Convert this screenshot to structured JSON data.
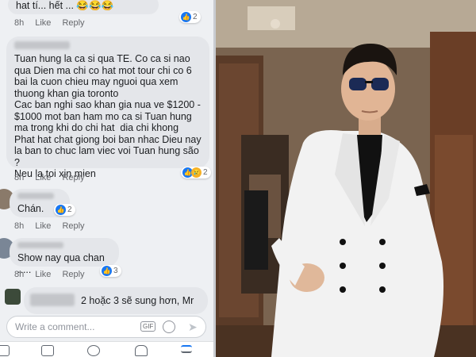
{
  "thread": {
    "top": {
      "text": "hat tí... hết ... 😂😂😂",
      "time": "8h",
      "like": "Like",
      "reply": "Reply",
      "reactions": "2"
    },
    "comments": [
      {
        "text": "Tuan hung la ca si qua TE. Co ca si nao qua Dien ma chi co hat mot tour chi co 6 bai la cuon chieu may nguoi qua xem thuong khan gia toronto\nCac ban nghi sao khan gia nua ve $1200 - $1000 mot ban ham mo ca si Tuan hung ma trong khi do chi hat  dia chi khong Phat hat chat giong boi ban nhac Dieu nay la ban to chuc lam viec voi Tuan hung são ?\nNeu la toi xin mien",
        "time": "8h",
        "like": "Like",
        "reply": "Reply",
        "reactions": "2"
      },
      {
        "text": "Chán.",
        "time": "8h",
        "like": "Like",
        "reply": "Reply",
        "reactions": "2"
      },
      {
        "text": "Show nay qua chan .....",
        "time": "8h",
        "like": "Like",
        "reply": "Reply",
        "reactions": "3"
      },
      {
        "text": "2 hoặc 3 sẽ sung hơn, Mr"
      }
    ]
  },
  "composer": {
    "placeholder": "Write a comment...",
    "gif_label": "GIF"
  },
  "colors": {
    "facebook_blue": "#1877f2",
    "bubble_gray": "#e4e6ea",
    "jacket_white": "#f2f2f2"
  },
  "icons": [
    "like-icon",
    "sad-face-icon",
    "emoji-icon",
    "send-icon",
    "gif-icon",
    "home-icon",
    "marketplace-icon",
    "groups-icon",
    "notifications-icon",
    "menu-icon"
  ]
}
